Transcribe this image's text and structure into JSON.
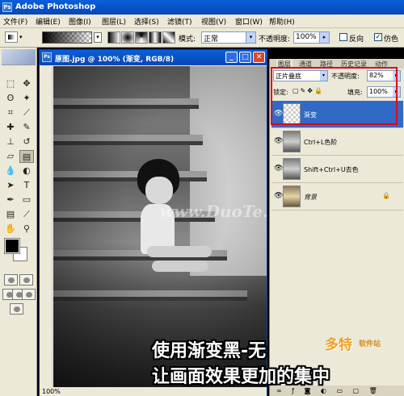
{
  "app": {
    "title": "Adobe Photoshop"
  },
  "menu": [
    "文件(F)",
    "编辑(E)",
    "图像(I)",
    "图层(L)",
    "选择(S)",
    "滤镜(T)",
    "视图(V)",
    "窗口(W)",
    "帮助(H)"
  ],
  "options": {
    "mode_label": "模式:",
    "mode_value": "正常",
    "opacity_label": "不透明度:",
    "opacity_value": "100%",
    "reverse_label": "反向",
    "dither_label": "仿色",
    "reverse_checked": false,
    "dither_checked": true
  },
  "document": {
    "title": "原图.jpg @ 100% (渐变, RGB/8)",
    "zoom": "100%",
    "watermark": "www.DuoTe.com"
  },
  "layers_panel": {
    "tabs": [
      "图层",
      "通道",
      "路径",
      "历史记录",
      "动作"
    ],
    "blend_mode": "正片叠底",
    "opacity_label": "不透明度:",
    "opacity_value": "82%",
    "lock_label": "锁定:",
    "fill_label": "填充:",
    "fill_value": "100%",
    "layers": [
      {
        "name": "渐变",
        "active": true,
        "visible": true
      },
      {
        "name": "Ctrl+L色阶",
        "active": false,
        "visible": true
      },
      {
        "name": "Shift+Ctrl+U去色",
        "active": false,
        "visible": true
      },
      {
        "name": "背景",
        "active": false,
        "visible": true,
        "locked": true
      }
    ]
  },
  "caption": {
    "line1": "使用渐变黑-无",
    "line2": "让画面效果更加的集中"
  },
  "logo": {
    "big": "多特",
    "small": "软件站"
  },
  "colors": {
    "titlebar": "#0846b6",
    "highlight": "#316ac5",
    "annotation": "#e0001a",
    "chrome": "#ece9d8"
  }
}
